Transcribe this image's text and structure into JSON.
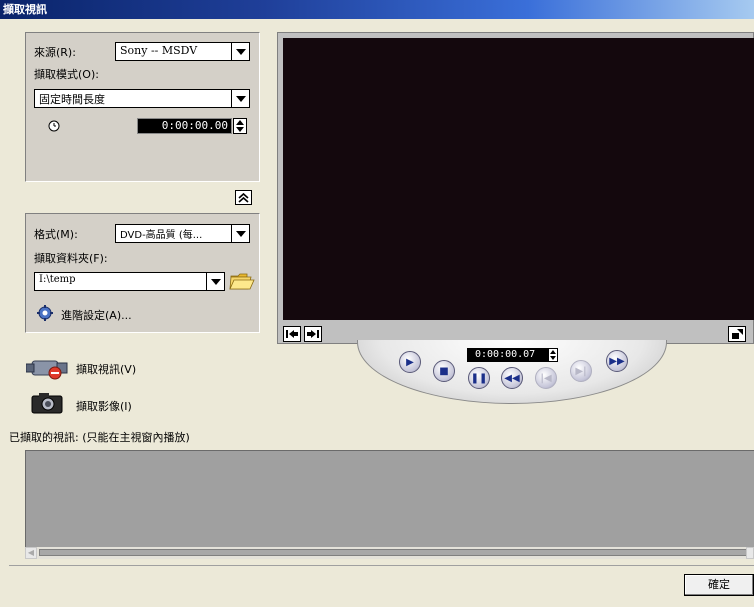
{
  "window": {
    "title": "擷取視訊"
  },
  "source": {
    "label": "來源(R):",
    "value": "Sony -- MSDV"
  },
  "capture_mode": {
    "label": "擷取模式(O):",
    "value": "固定時間長度"
  },
  "duration": {
    "value": "0:00:00.00"
  },
  "format": {
    "label": "格式(M):",
    "value": "DVD-高品質 (每..."
  },
  "folder": {
    "label": "擷取資料夾(F):",
    "value": "I:\\temp"
  },
  "advanced": {
    "label": "進階設定(A)..."
  },
  "actions": {
    "capture_video": "擷取視訊(V)",
    "capture_image": "擷取影像(I)"
  },
  "captured_list": {
    "label": "已擷取的視訊: (只能在主視窗內播放)"
  },
  "player": {
    "timecode": "0:00:00.07"
  },
  "footer": {
    "ok_label": "確定"
  }
}
